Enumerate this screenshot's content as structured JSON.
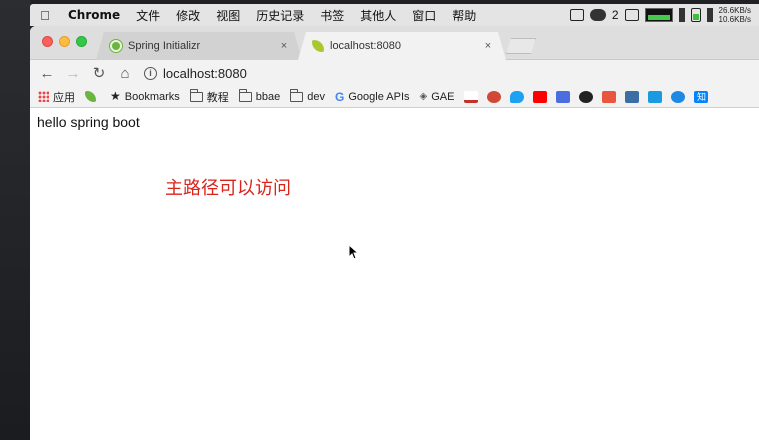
{
  "menubar": {
    "app_name": "Chrome",
    "menus": [
      "文件",
      "修改",
      "视图",
      "历史记录",
      "书签",
      "其他人",
      "窗口",
      "帮助"
    ],
    "status_count": "2",
    "net_up": "26.6KB/s",
    "net_down": "10.6KB/s"
  },
  "tabs": [
    {
      "title": "Spring Initializr",
      "close": "×"
    },
    {
      "title": "localhost:8080",
      "close": "×"
    }
  ],
  "toolbar": {
    "back": "←",
    "forward": "→",
    "reload": "↻",
    "home": "⌂",
    "info": "i",
    "url": "localhost:8080"
  },
  "bookmarks": {
    "apps": "应用",
    "items": [
      "Bookmarks",
      "教程",
      "bbae",
      "dev",
      "Google APIs",
      "GAE"
    ],
    "colors": [
      "#c4302b",
      "#d14836",
      "#1da1f2",
      "#ff0000",
      "#4a6ee0",
      "#222222",
      "#e8563f",
      "#3a6ea5",
      "#1a9ae0",
      "#1e88e5",
      "#0084ff"
    ],
    "last_label": "知"
  },
  "page": {
    "body_text": "hello spring boot",
    "annotation": "主路径可以访问"
  }
}
